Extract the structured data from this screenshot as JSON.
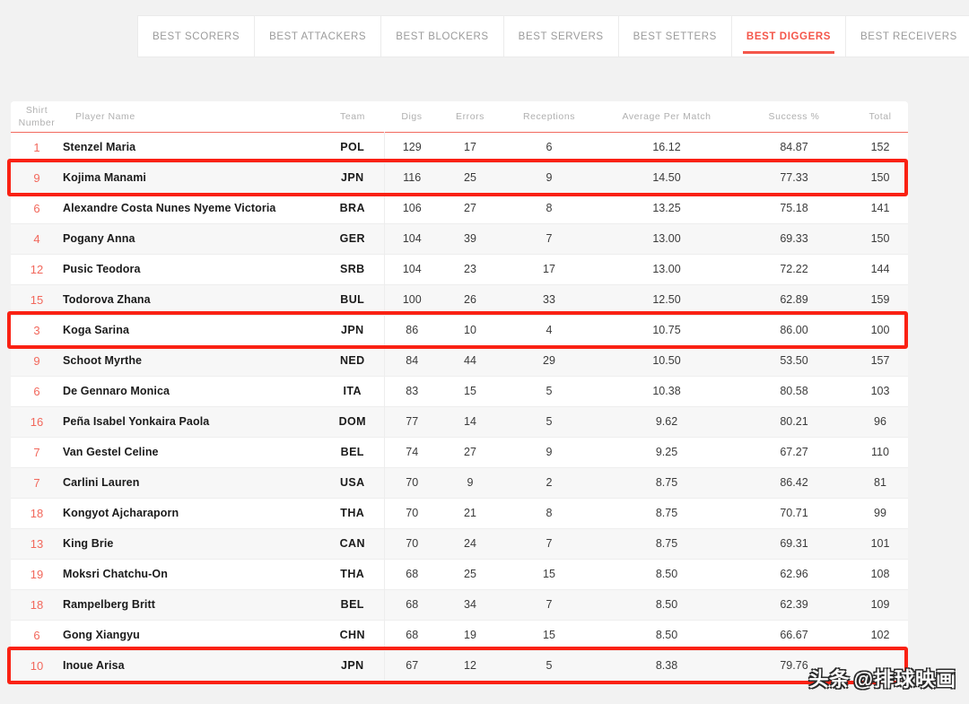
{
  "colors": {
    "page_background": "#F2F2F2",
    "accent_coral": "#F4564A",
    "highlight_red": "#FA2113",
    "shirt_number": "#F2685C",
    "row_alt": "#F7F7F7"
  },
  "tabs": [
    {
      "label": "BEST SCORERS",
      "active": false
    },
    {
      "label": "BEST ATTACKERS",
      "active": false
    },
    {
      "label": "BEST BLOCKERS",
      "active": false
    },
    {
      "label": "BEST SERVERS",
      "active": false
    },
    {
      "label": "BEST SETTERS",
      "active": false
    },
    {
      "label": "BEST DIGGERS",
      "active": true
    },
    {
      "label": "BEST RECEIVERS",
      "active": false
    }
  ],
  "table": {
    "headers": {
      "shirt_line1": "Shirt",
      "shirt_line2": "Number",
      "player_name": "Player Name",
      "team": "Team",
      "digs": "Digs",
      "errors": "Errors",
      "receptions": "Receptions",
      "average_per_match": "Average Per Match",
      "success_pct": "Success %",
      "total": "Total"
    },
    "rows": [
      {
        "shirt": "1",
        "name": "Stenzel Maria",
        "team": "POL",
        "digs": "129",
        "errors": "17",
        "receptions": "6",
        "average": "16.12",
        "success": "84.87",
        "total": "152",
        "highlighted": false
      },
      {
        "shirt": "9",
        "name": "Kojima Manami",
        "team": "JPN",
        "digs": "116",
        "errors": "25",
        "receptions": "9",
        "average": "14.50",
        "success": "77.33",
        "total": "150",
        "highlighted": true
      },
      {
        "shirt": "6",
        "name": "Alexandre Costa Nunes Nyeme Victoria",
        "team": "BRA",
        "digs": "106",
        "errors": "27",
        "receptions": "8",
        "average": "13.25",
        "success": "75.18",
        "total": "141",
        "highlighted": false
      },
      {
        "shirt": "4",
        "name": "Pogany Anna",
        "team": "GER",
        "digs": "104",
        "errors": "39",
        "receptions": "7",
        "average": "13.00",
        "success": "69.33",
        "total": "150",
        "highlighted": false
      },
      {
        "shirt": "12",
        "name": "Pusic Teodora",
        "team": "SRB",
        "digs": "104",
        "errors": "23",
        "receptions": "17",
        "average": "13.00",
        "success": "72.22",
        "total": "144",
        "highlighted": false
      },
      {
        "shirt": "15",
        "name": "Todorova Zhana",
        "team": "BUL",
        "digs": "100",
        "errors": "26",
        "receptions": "33",
        "average": "12.50",
        "success": "62.89",
        "total": "159",
        "highlighted": false
      },
      {
        "shirt": "3",
        "name": "Koga Sarina",
        "team": "JPN",
        "digs": "86",
        "errors": "10",
        "receptions": "4",
        "average": "10.75",
        "success": "86.00",
        "total": "100",
        "highlighted": true
      },
      {
        "shirt": "9",
        "name": "Schoot Myrthe",
        "team": "NED",
        "digs": "84",
        "errors": "44",
        "receptions": "29",
        "average": "10.50",
        "success": "53.50",
        "total": "157",
        "highlighted": false
      },
      {
        "shirt": "6",
        "name": "De Gennaro Monica",
        "team": "ITA",
        "digs": "83",
        "errors": "15",
        "receptions": "5",
        "average": "10.38",
        "success": "80.58",
        "total": "103",
        "highlighted": false
      },
      {
        "shirt": "16",
        "name": "Peña Isabel Yonkaira Paola",
        "team": "DOM",
        "digs": "77",
        "errors": "14",
        "receptions": "5",
        "average": "9.62",
        "success": "80.21",
        "total": "96",
        "highlighted": false
      },
      {
        "shirt": "7",
        "name": "Van Gestel Celine",
        "team": "BEL",
        "digs": "74",
        "errors": "27",
        "receptions": "9",
        "average": "9.25",
        "success": "67.27",
        "total": "110",
        "highlighted": false
      },
      {
        "shirt": "7",
        "name": "Carlini Lauren",
        "team": "USA",
        "digs": "70",
        "errors": "9",
        "receptions": "2",
        "average": "8.75",
        "success": "86.42",
        "total": "81",
        "highlighted": false
      },
      {
        "shirt": "18",
        "name": "Kongyot Ajcharaporn",
        "team": "THA",
        "digs": "70",
        "errors": "21",
        "receptions": "8",
        "average": "8.75",
        "success": "70.71",
        "total": "99",
        "highlighted": false
      },
      {
        "shirt": "13",
        "name": "King Brie",
        "team": "CAN",
        "digs": "70",
        "errors": "24",
        "receptions": "7",
        "average": "8.75",
        "success": "69.31",
        "total": "101",
        "highlighted": false
      },
      {
        "shirt": "19",
        "name": "Moksri Chatchu-On",
        "team": "THA",
        "digs": "68",
        "errors": "25",
        "receptions": "15",
        "average": "8.50",
        "success": "62.96",
        "total": "108",
        "highlighted": false
      },
      {
        "shirt": "18",
        "name": "Rampelberg Britt",
        "team": "BEL",
        "digs": "68",
        "errors": "34",
        "receptions": "7",
        "average": "8.50",
        "success": "62.39",
        "total": "109",
        "highlighted": false
      },
      {
        "shirt": "6",
        "name": "Gong Xiangyu",
        "team": "CHN",
        "digs": "68",
        "errors": "19",
        "receptions": "15",
        "average": "8.50",
        "success": "66.67",
        "total": "102",
        "highlighted": false
      },
      {
        "shirt": "10",
        "name": "Inoue Arisa",
        "team": "JPN",
        "digs": "67",
        "errors": "12",
        "receptions": "5",
        "average": "8.38",
        "success": "79.76",
        "total": "",
        "highlighted": true
      }
    ]
  },
  "watermark": {
    "prefix": "头条",
    "handle": "@排球映画"
  }
}
